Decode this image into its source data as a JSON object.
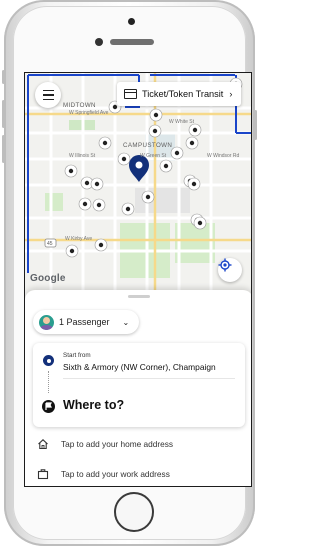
{
  "map": {
    "street_labels": [
      "MIDTOWN",
      "CAMPUSTOWN",
      "W Springfield Ave",
      "W Illinois St",
      "W Green St",
      "W White St",
      "W Kirby Ave",
      "W Windsor Rd"
    ],
    "route_number": "45",
    "ticket_button_label": "Ticket/Token Transit",
    "google_logo_text": "Google",
    "accent_color": "#13307a"
  },
  "sheet": {
    "passenger_label": "1 Passenger",
    "start_caption": "Start from",
    "start_address": "Sixth & Armory (NW Corner), Champaign",
    "destination_prompt": "Where to?",
    "home_prompt": "Tap to add your home address",
    "work_prompt": "Tap to add your work address"
  },
  "icons": {
    "menu": "hamburger-icon",
    "ticket": "ticket-icon",
    "locate": "locate-icon",
    "passenger": "passenger-avatar-icon",
    "home": "home-icon",
    "work": "briefcase-icon"
  }
}
